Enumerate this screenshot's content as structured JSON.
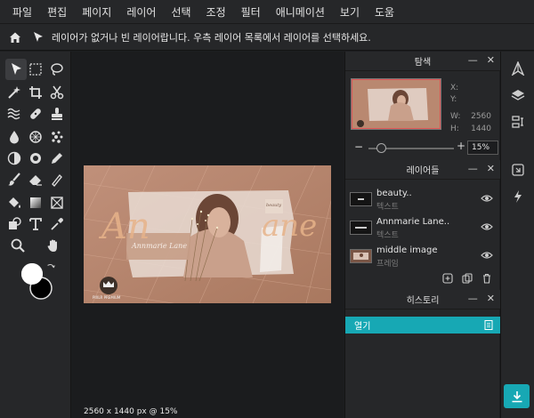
{
  "menu": [
    "파일",
    "편집",
    "페이지",
    "레이어",
    "선택",
    "조정",
    "필터",
    "애니메이션",
    "보기",
    "도움"
  ],
  "infobar": {
    "message": "레이어가 없거나 빈 레이어랍니다. 우측 레이어 목록에서 레이어를 선택하세요."
  },
  "canvas": {
    "status": "2560 x 1440 px @ 15%",
    "script_text_left": "An",
    "script_text_right": "ane",
    "card_text": "Annmarie Lane",
    "tag_text": "beauty",
    "logo_text": "PIXLR PREMIUM"
  },
  "navigator": {
    "title": "탐색",
    "x_label": "X:",
    "y_label": "Y:",
    "w_label": "W:",
    "h_label": "H:",
    "w_value": "2560",
    "h_value": "1440",
    "zoom_minus": "−",
    "zoom_plus": "+",
    "zoom_value": "15%",
    "zoom_slider_fraction": 0.15
  },
  "layers": {
    "title": "레이어들",
    "items": [
      {
        "name": "beauty..",
        "type": "텍스트"
      },
      {
        "name": "Annmarie Lane..",
        "type": "텍스트"
      },
      {
        "name": "middle image",
        "type": "프레임"
      }
    ]
  },
  "history": {
    "title": "히스토리",
    "items": [
      "열기"
    ]
  },
  "colors": {
    "accent": "#17a8b4",
    "foreground_swatch": "#ffffff",
    "background_swatch": "#000000",
    "artboard": "#b98870"
  }
}
